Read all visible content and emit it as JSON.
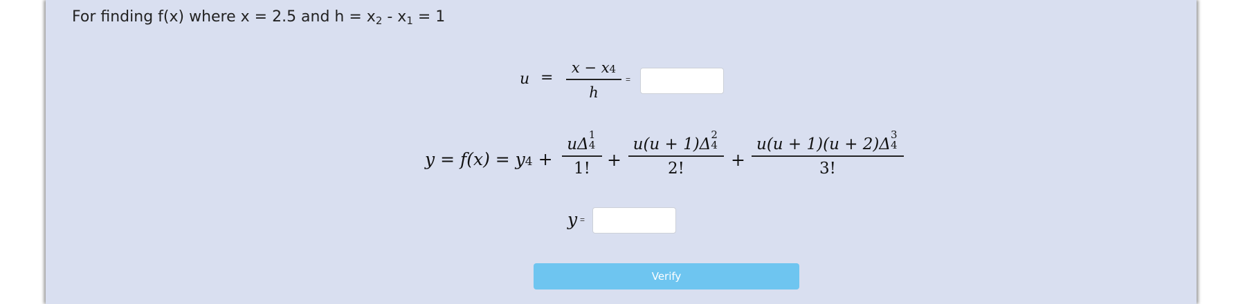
{
  "heading": {
    "prefix": "For finding f(x) where x = 2.5 and h = x",
    "sub_a": "2",
    "mid": " - x",
    "sub_b": "1",
    "suffix": " = 1"
  },
  "u_equation": {
    "lhs": "u",
    "eq": "=",
    "numerator": "x − x",
    "numerator_sub": "4",
    "denominator": "h",
    "equals_small": "=",
    "input_value": "",
    "input_placeholder": ""
  },
  "y_equation": {
    "lhs": "y = f(x) = y",
    "lhs_sub": "4",
    "plus": "+",
    "term1_num": "uΔ",
    "term1_sup": "1",
    "term1_sub": "4",
    "term1_den": "1!",
    "term2_num": "u(u + 1)Δ",
    "term2_sup": "2",
    "term2_sub": "4",
    "term2_den": "2!",
    "term3_num": "u(u + 1)(u + 2)Δ",
    "term3_sup": "3",
    "term3_sub": "4",
    "term3_den": "3!"
  },
  "y_answer": {
    "label": "y",
    "equals_small": "=",
    "input_value": "",
    "input_placeholder": ""
  },
  "verify_button": {
    "label": "Verify"
  }
}
